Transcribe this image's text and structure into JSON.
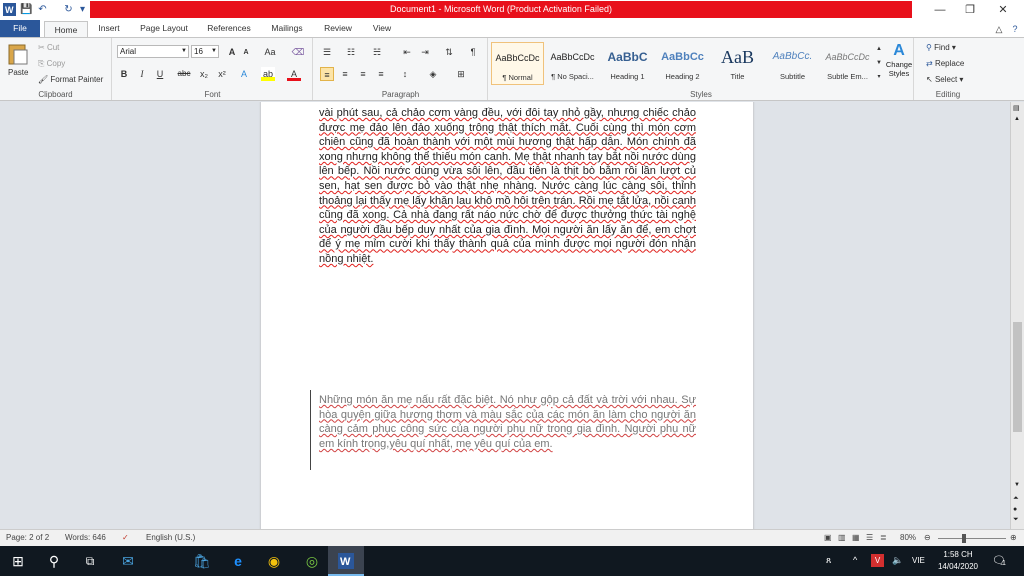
{
  "window": {
    "title": "Document1 - Microsoft Word (Product Activation Failed)",
    "controls": {
      "minimize": "—",
      "restore": "❐",
      "close": "✕"
    }
  },
  "tabs": [
    "File",
    "Home",
    "Insert",
    "Page Layout",
    "References",
    "Mailings",
    "Review",
    "View"
  ],
  "clipboard": {
    "paste": "Paste",
    "cut": "Cut",
    "copy": "Copy",
    "format_painter": "Format Painter",
    "label": "Clipboard"
  },
  "font": {
    "name": "Arial",
    "size": "16",
    "label": "Font",
    "change_case": "Aa",
    "grow": "A",
    "shrink": "A"
  },
  "paragraph": {
    "label": "Paragraph"
  },
  "styles": {
    "label": "Styles",
    "items": [
      {
        "preview": "AaBbCcDc",
        "name": "¶ Normal"
      },
      {
        "preview": "AaBbCcDc",
        "name": "¶ No Spaci..."
      },
      {
        "preview": "AaBbC",
        "name": "Heading 1"
      },
      {
        "preview": "AaBbCc",
        "name": "Heading 2"
      },
      {
        "preview": "AaB",
        "name": "Title"
      },
      {
        "preview": "AaBbCc.",
        "name": "Subtitle"
      },
      {
        "preview": "AaBbCcDc",
        "name": "Subtle Em..."
      }
    ],
    "change_styles": "Change Styles"
  },
  "editing": {
    "find": "Find",
    "replace": "Replace",
    "select": "Select",
    "label": "Editing"
  },
  "document": {
    "para1": "vài phút sau, cả chảo cơm vàng đều, với đôi tay nhỏ gầy, nhưng chiếc chảo được mẹ đảo lên đảo xuống trông thật thích mắt. Cuối cùng thì món cơm chiên cũng đã hoàn thành với một mùi hương thật hấp dẫn. Món chính đã xong nhưng không thể thiếu món canh. Mẹ thật nhanh tay bắt nồi nước dùng lên bếp. Nồi nước dùng vừa sôi lên, đầu tiên là thịt bò bằm rồi lần lượt củ sen, hạt sen được bỏ vào thật nhẹ nhàng. Nước càng lúc càng sôi, thỉnh thoảng lại thấy mẹ lấy khăn lau khô mồ hôi trên trán. Rồi mẹ tắt lửa, nồi canh cũng đã xong. Cả nhà đang rất náo nức chờ để được thưởng thức tài nghệ của người đầu bếp duy nhất của gia đình. Mọi người ăn lấy ăn để, em chợt để ý mẹ mỉm cười khi thấy thành quả của mình được mọi người đón nhận nồng nhiệt.",
    "para2": "Những món ăn mẹ nấu rất đặc biệt. Nó như gộp cả đất và trời với nhau. Sự hòa quyện giữa hương thơm và màu sắc của các món ăn làm cho người ăn càng cảm phục công sức của người phụ nữ trong gia đình. Người phụ nữ em kính trọng,yêu quí nhất, mẹ yêu quí của em."
  },
  "status": {
    "page": "Page: 2 of 2",
    "words": "Words: 646",
    "language": "English (U.S.)",
    "zoom": "80%",
    "zoom_level": 0.8
  },
  "taskbar": {
    "time": "1:58 CH",
    "date": "14/04/2020",
    "lang": "VIE",
    "notifications": "1"
  },
  "colors": {
    "accent": "#2b579a",
    "title_alert": "#e8101b",
    "taskbar": "#101820"
  }
}
